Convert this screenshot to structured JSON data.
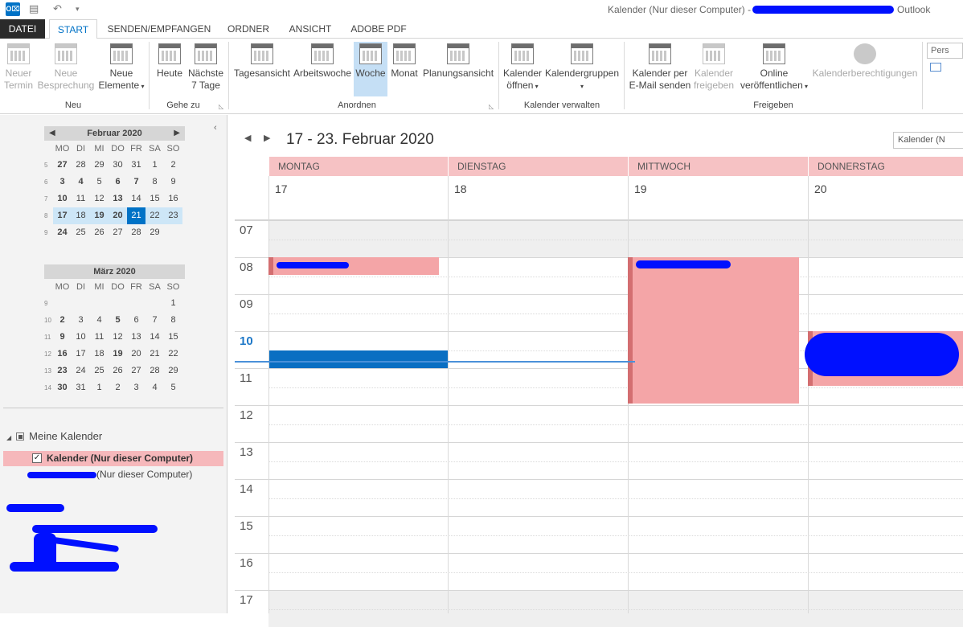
{
  "titlebar": {
    "window_title": "Kalender (Nur dieser Computer) -",
    "app_name": "Outlook"
  },
  "ribbon_tabs": [
    "DATEI",
    "START",
    "SENDEN/EMPFANGEN",
    "ORDNER",
    "ANSICHT",
    "ADOBE PDF"
  ],
  "ribbon": {
    "new_appointment": [
      "Neuer",
      "Termin"
    ],
    "new_meeting": [
      "Neue",
      "Besprechung"
    ],
    "new_items": [
      "Neue",
      "Elemente"
    ],
    "today": "Heute",
    "next7": [
      "Nächste",
      "7 Tage"
    ],
    "day_view": "Tagesansicht",
    "work_week": "Arbeitswoche",
    "week": "Woche",
    "month": "Monat",
    "schedule": "Planungsansicht",
    "open_calendar": [
      "Kalender",
      "öffnen"
    ],
    "calendar_groups": "Kalendergruppen",
    "email_calendar": [
      "Kalender per",
      "E-Mail senden"
    ],
    "share_calendar": [
      "Kalender",
      "freigeben"
    ],
    "publish_online": [
      "Online",
      "veröffentlichen"
    ],
    "permissions": "Kalenderberechtigungen",
    "groups": {
      "neu": "Neu",
      "gehe_zu": "Gehe zu",
      "anordnen": "Anordnen",
      "kalender_verwalten": "Kalender verwalten",
      "freigeben": "Freigeben"
    },
    "search_placeholder": "Pers"
  },
  "mini_calendars": [
    {
      "title": "Februar 2020",
      "weekdays": [
        "MO",
        "DI",
        "MI",
        "DO",
        "FR",
        "SA",
        "SO"
      ],
      "weeks": [
        {
          "kw": "5",
          "days": [
            "27",
            "28",
            "29",
            "30",
            "31",
            "1",
            "2"
          ]
        },
        {
          "kw": "6",
          "days": [
            "3",
            "4",
            "5",
            "6",
            "7",
            "8",
            "9"
          ]
        },
        {
          "kw": "7",
          "days": [
            "10",
            "11",
            "12",
            "13",
            "14",
            "15",
            "16"
          ]
        },
        {
          "kw": "8",
          "days": [
            "17",
            "18",
            "19",
            "20",
            "21",
            "22",
            "23"
          ]
        },
        {
          "kw": "9",
          "days": [
            "24",
            "25",
            "26",
            "27",
            "28",
            "29",
            ""
          ]
        }
      ],
      "bold": [
        "3-4",
        "4-5",
        "6-7",
        "7-8",
        "10-0",
        "10-1",
        "10-2",
        "13-3",
        "17-0",
        "19-2",
        "20-3",
        "24-0"
      ]
    },
    {
      "title": "März 2020",
      "weekdays": [
        "MO",
        "DI",
        "MI",
        "DO",
        "FR",
        "SA",
        "SO"
      ],
      "weeks": [
        {
          "kw": "9",
          "days": [
            "",
            "",
            "",
            "",
            "",
            "",
            "1"
          ]
        },
        {
          "kw": "10",
          "days": [
            "2",
            "3",
            "4",
            "5",
            "6",
            "7",
            "8"
          ]
        },
        {
          "kw": "11",
          "days": [
            "9",
            "10",
            "11",
            "12",
            "13",
            "14",
            "15"
          ]
        },
        {
          "kw": "12",
          "days": [
            "16",
            "17",
            "18",
            "19",
            "20",
            "21",
            "22"
          ]
        },
        {
          "kw": "13",
          "days": [
            "23",
            "24",
            "25",
            "26",
            "27",
            "28",
            "29"
          ]
        },
        {
          "kw": "14",
          "days": [
            "30",
            "31",
            "1",
            "2",
            "3",
            "4",
            "5"
          ]
        }
      ]
    }
  ],
  "today_date": "21",
  "calendar_list": {
    "group": "Meine Kalender",
    "items": [
      {
        "label": "Kalender (Nur dieser Computer)",
        "checked": true
      },
      {
        "label": "(Nur dieser Computer)",
        "checked": false
      }
    ]
  },
  "main": {
    "range_title": "17 - 23. Februar 2020",
    "search_placeholder": "Kalender (N",
    "days": [
      {
        "name": "MONTAG",
        "date": "17"
      },
      {
        "name": "DIENSTAG",
        "date": "18"
      },
      {
        "name": "MITTWOCH",
        "date": "19"
      },
      {
        "name": "DONNERSTAG",
        "date": "20"
      }
    ],
    "hours": [
      "07",
      "08",
      "09",
      "10",
      "11",
      "12",
      "13",
      "14",
      "15",
      "16",
      "17"
    ],
    "current_hour": "10"
  },
  "colors": {
    "accent": "#0072c6",
    "event_fill": "#f4a5a7",
    "event_border": "#d36e70",
    "day_header": "#f6c2c4",
    "redaction": "#0010ff"
  }
}
